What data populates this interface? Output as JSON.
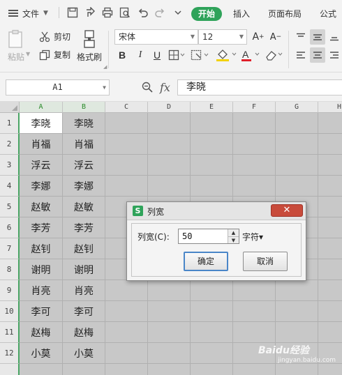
{
  "menu": {
    "file_label": "文件",
    "tabs": [
      "开始",
      "插入",
      "页面布局",
      "公式"
    ]
  },
  "ribbon": {
    "paste_label": "粘贴",
    "cut_label": "剪切",
    "copy_label": "复制",
    "format_painter_label": "格式刷",
    "font_name": "宋体",
    "font_size": "12",
    "bold": "B",
    "italic": "I",
    "underline": "U"
  },
  "formula_bar": {
    "cell_ref": "A1",
    "fx": "fx",
    "content": "李晓"
  },
  "sheet": {
    "columns": [
      "A",
      "B",
      "C",
      "D",
      "E",
      "F",
      "G",
      "H"
    ],
    "rows": [
      [
        "李晓",
        "李晓"
      ],
      [
        "肖福",
        "肖福"
      ],
      [
        "浮云",
        "浮云"
      ],
      [
        "李娜",
        "李娜"
      ],
      [
        "赵敏",
        "赵敏"
      ],
      [
        "李芳",
        "李芳"
      ],
      [
        "赵钊",
        "赵钊"
      ],
      [
        "谢明",
        "谢明"
      ],
      [
        "肖亮",
        "肖亮"
      ],
      [
        "李可",
        "李可"
      ],
      [
        "赵梅",
        "赵梅"
      ],
      [
        "小莫",
        "小莫"
      ]
    ]
  },
  "dialog": {
    "icon_letter": "S",
    "title": "列宽",
    "label": "列宽(C):",
    "value": "50",
    "unit": "字符▾",
    "ok_label": "确定",
    "cancel_label": "取消",
    "close_glyph": "✕"
  },
  "watermark": {
    "main": "Baidu经验",
    "sub": "jingyan.baidu.com"
  },
  "colors": {
    "accent_green": "#2fa35a",
    "close_red": "#c84b3b"
  }
}
